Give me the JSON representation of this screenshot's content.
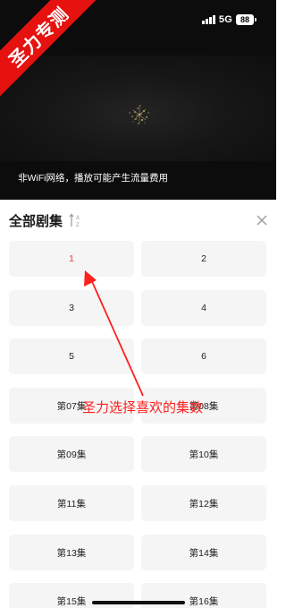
{
  "status_bar": {
    "network": "5G",
    "battery": "88"
  },
  "watermark": "圣力专测",
  "video": {
    "notice": "非WiFi网络，播放可能产生流量费用"
  },
  "sheet": {
    "title": "全部剧集",
    "sort_icon": "sort-az-icon",
    "close_icon": "close-icon"
  },
  "episodes": [
    "1",
    "2",
    "3",
    "4",
    "5",
    "6",
    "第07集",
    "第08集",
    "第09集",
    "第10集",
    "第11集",
    "第12集",
    "第13集",
    "第14集",
    "第15集",
    "第16集"
  ],
  "selected_episode": "1",
  "annotation": {
    "text": "圣力选择喜欢的集数",
    "color": "#ff1f1f"
  },
  "colors": {
    "accent": "#e6423d",
    "tile": "#f5f5f5",
    "watermark": "#e5120f"
  }
}
